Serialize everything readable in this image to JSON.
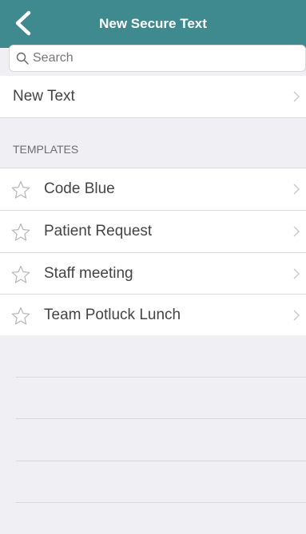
{
  "nav": {
    "title": "New Secure Text",
    "back_icon": "chevron-left-icon"
  },
  "search": {
    "placeholder": "Search",
    "value": ""
  },
  "new_text": {
    "label": "New Text"
  },
  "templates": {
    "header": "TEMPLATES",
    "items": [
      {
        "label": "Code Blue",
        "icon": "star-outline-icon"
      },
      {
        "label": "Patient Request",
        "icon": "star-outline-icon"
      },
      {
        "label": "Staff meeting",
        "icon": "star-outline-icon"
      },
      {
        "label": "Team Potluck Lunch",
        "icon": "star-outline-icon"
      }
    ]
  },
  "colors": {
    "nav_bar": "#3f8a8e",
    "background": "#efeff4",
    "row": "#ffffff",
    "separator": "#d9d9dd"
  }
}
